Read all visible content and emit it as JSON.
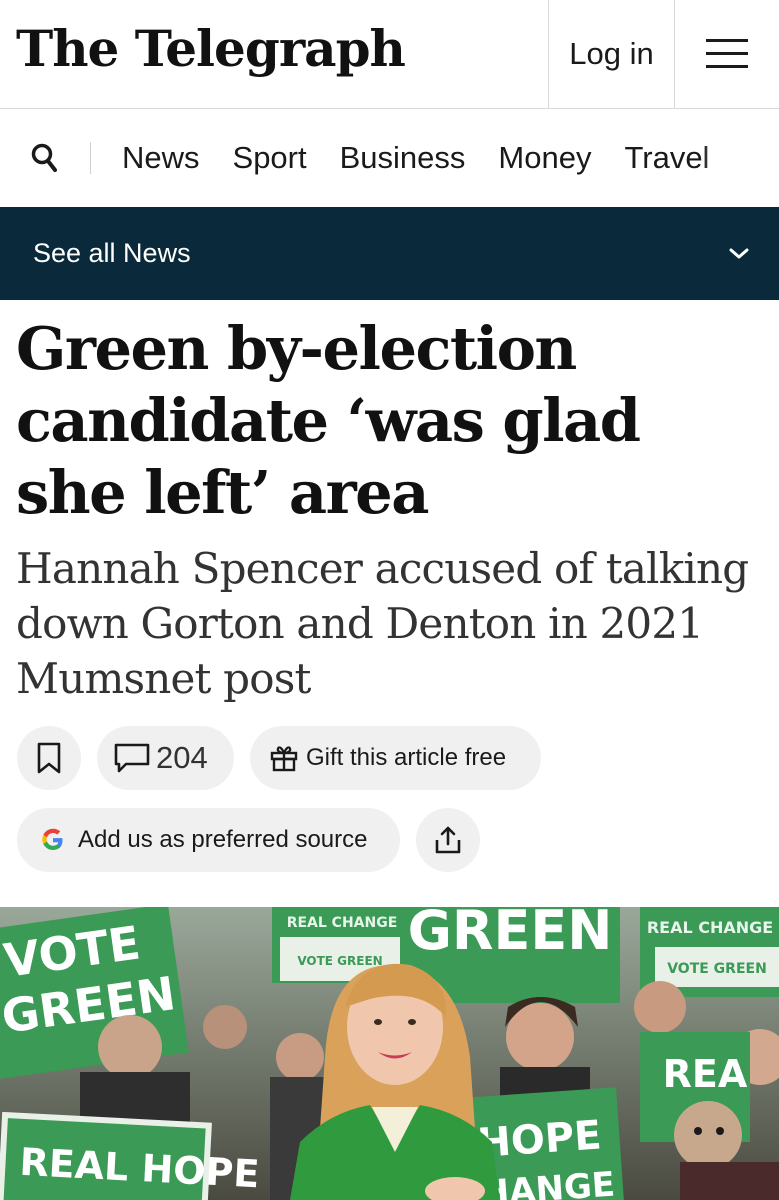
{
  "header": {
    "logo": "The Telegraph",
    "login_label": "Log in",
    "menu_icon": "hamburger-icon"
  },
  "nav": {
    "search_icon": "search-icon",
    "items": [
      "News",
      "Sport",
      "Business",
      "Money",
      "Travel"
    ]
  },
  "section": {
    "label": "See all News",
    "icon": "chevron-down-icon"
  },
  "article": {
    "headline": "Green by-election candidate ‘was glad she left’ area",
    "standfirst": "Hannah Spencer accused of talking down Gorton and Denton in 2021 Mumsnet post"
  },
  "actions": {
    "comment_count": "204",
    "gift_label": "Gift this article free",
    "preferred_source_label": "Add us as preferred source"
  },
  "hero": {
    "signs": [
      "VOTE",
      "GREEN",
      "REAL CHANGE",
      "VOTE GREEN",
      "GREEN",
      "REAL CHANGE",
      "VOTE GREEN",
      "REA",
      "REAL HOPE",
      "HOPE",
      "HANGE"
    ]
  },
  "colors": {
    "section_bar": "#0a2a3c",
    "pill_bg": "#f0f0f0",
    "green_sign": "#3a9a56"
  }
}
